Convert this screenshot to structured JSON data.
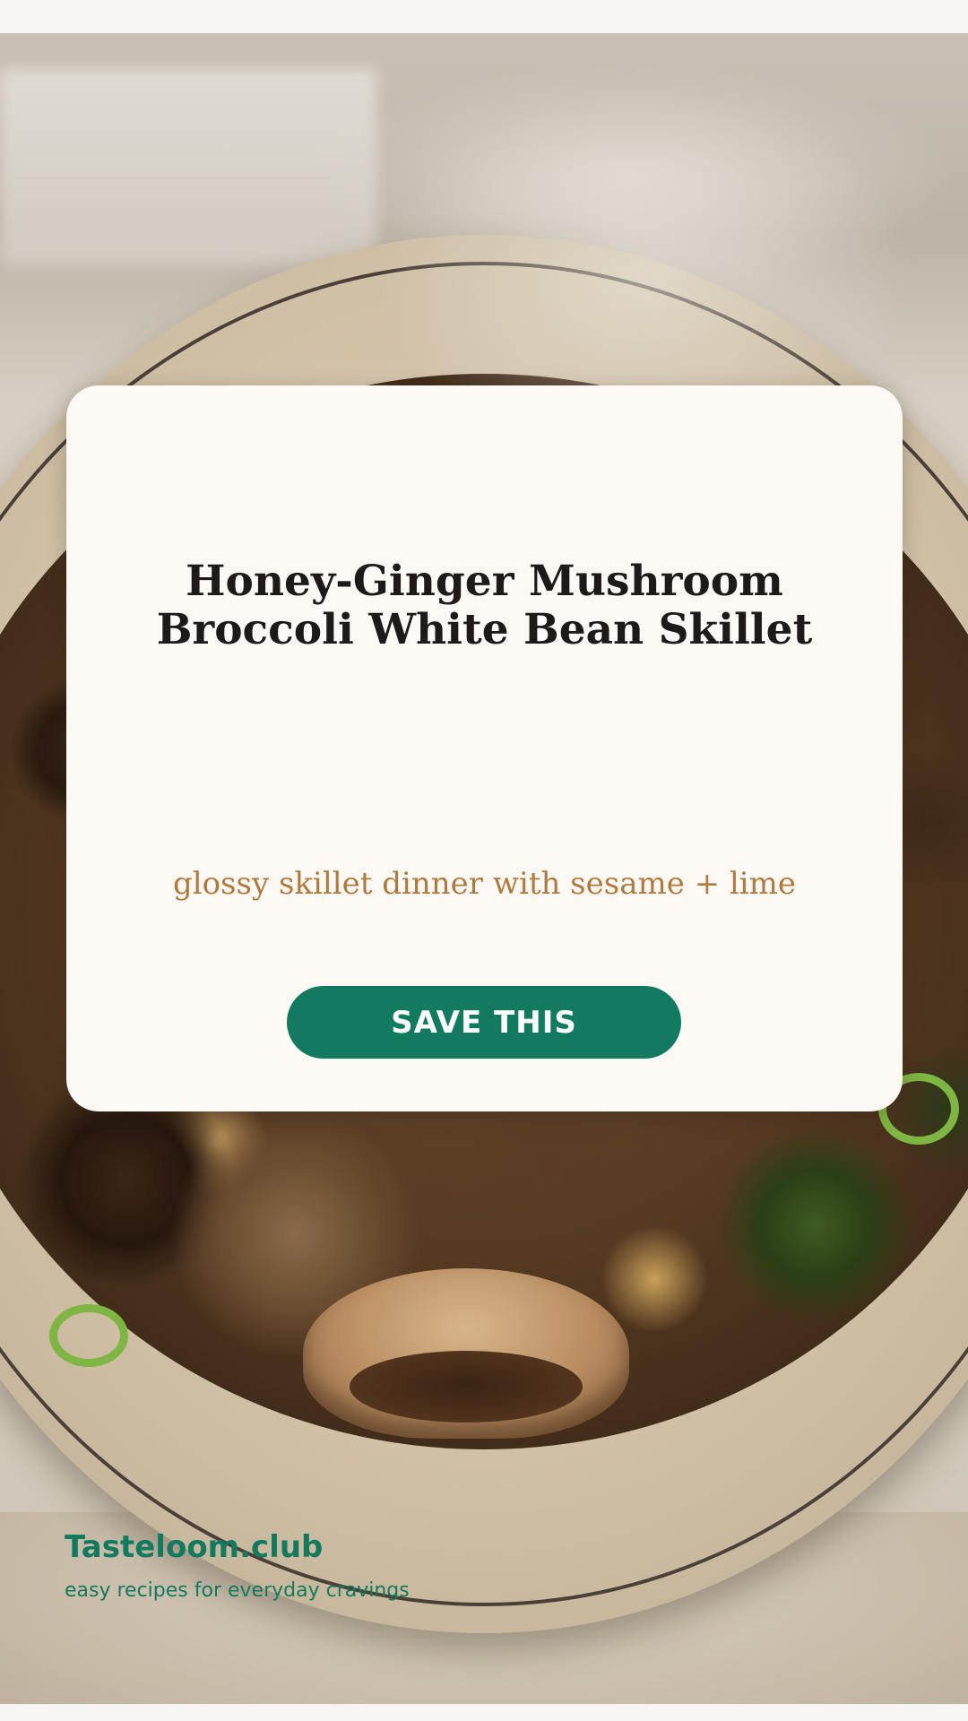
{
  "card": {
    "title": "Honey-Ginger Mushroom Broccoli White Bean Skillet",
    "subtitle": "glossy skillet dinner with sesame + lime",
    "button_label": "SAVE THIS"
  },
  "footer": {
    "brand": "Tasteloom.club",
    "tagline": "easy recipes for everyday cravings"
  },
  "colors": {
    "accent": "#117a5f",
    "card_background": "#fcf8f4",
    "subtitle": "#b07a3e",
    "title": "#1f1a17"
  }
}
